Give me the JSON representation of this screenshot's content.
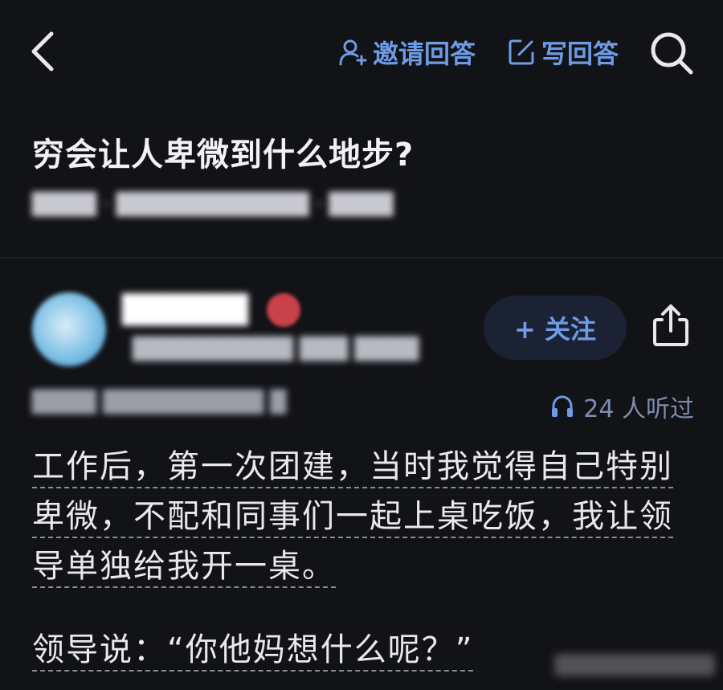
{
  "header": {
    "invite_label": "邀请回答",
    "write_label": "写回答"
  },
  "question": {
    "title": "穷会让人卑微到什么地步?",
    "meta_blurred": "████ · ████████████ · ████"
  },
  "author": {
    "name_blurred": "██████",
    "subtitle_blurred": "██████████ ███ ████"
  },
  "follow_label": "+ 关注",
  "answer": {
    "date_blurred": "████ ██████████ █",
    "listeners": "24 人听过",
    "lines": [
      "工作后，第一次团建，当时我觉得自己特别",
      "卑微，不配和同事们一起上桌吃饭，我让领",
      "导单独给我开一桌。",
      "领导说：“你他妈想什么呢？”"
    ]
  },
  "colors": {
    "background": "#121317",
    "accent_blue": "#6e9be6",
    "text": "#e9e9ec",
    "follow_bg": "#1b2233"
  }
}
